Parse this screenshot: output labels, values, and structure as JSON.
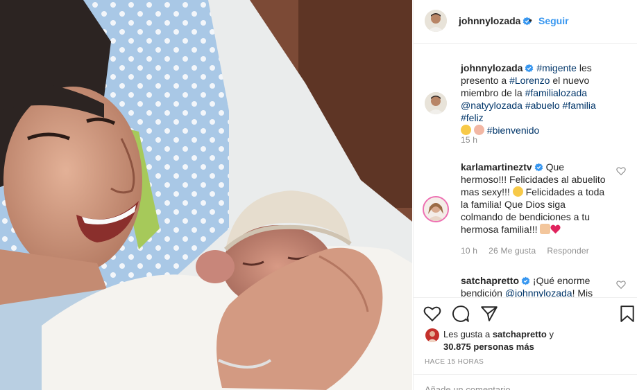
{
  "post": {
    "author": "johnnylozada",
    "follow_label": "Seguir",
    "dot": "•"
  },
  "caption": {
    "username": "johnnylozada",
    "line1_tag": "#migente",
    "line1_text": " les",
    "line2_text": "presento a ",
    "line2_tag": "#Lorenzo",
    "line2_text2": " el nuevo",
    "line3_text": "miembro de la ",
    "line3_tag": "#familialozada",
    "line4_tag1": "@natyylozada",
    "line4_tag2": "#abuelo",
    "line4_tag3": "#familia",
    "line4_tag4": "#feliz",
    "line5_tag": "#bienvenido",
    "time": "15 h"
  },
  "comment1": {
    "username": "karlamartineztv",
    "line1": "Que",
    "line2": "hermoso!!! Felicidades al abuelito",
    "line3a": "mas sexy!!! ",
    "line3b": " Felicidades a toda",
    "line4": "la familia! Que Dios siga",
    "line5": "colmando de bendiciones a tu",
    "line6": "hermosa familia!!! ",
    "time": "10 h",
    "likes": "26 Me gusta",
    "reply": "Responder"
  },
  "comment2": {
    "username": "satchapretto",
    "line1": "¡Qué enorme",
    "line2a": "bendición ",
    "line2_tag": "@johnnylozada",
    "line2b": "! Mis"
  },
  "likes": {
    "prefix": "Les gusta a ",
    "user": "satchapretto",
    "joiner": " y",
    "count": "30.875 personas más"
  },
  "timestamp": "HACE 15 HORAS",
  "add_comment_placeholder": "Añade un comentario...",
  "icons": [
    "verified-badge-icon",
    "heart-icon",
    "comment-icon",
    "share-icon",
    "bookmark-icon"
  ],
  "colors": {
    "link": "#003569",
    "follow": "#3897f0",
    "verified": "#3897f0",
    "muted": "#8e8e8e",
    "heart_red": "#ed4956"
  }
}
